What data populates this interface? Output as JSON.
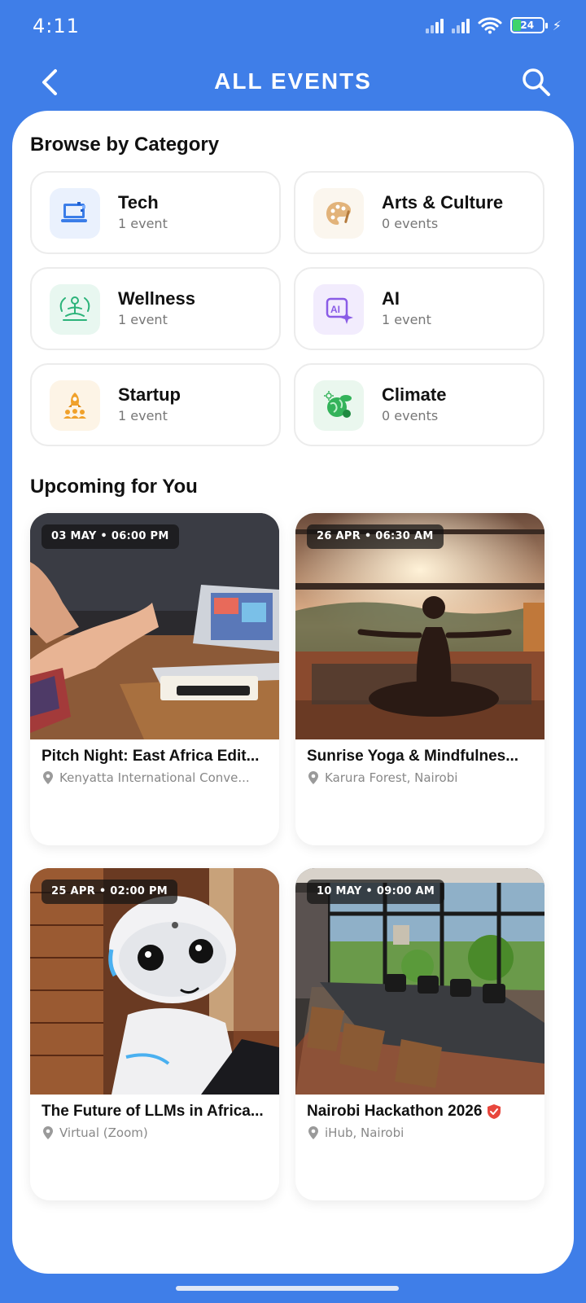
{
  "status_bar": {
    "time": "4:11",
    "battery": "24"
  },
  "header": {
    "title": "ALL EVENTS",
    "back_icon": "chevron-left-icon",
    "search_icon": "search-icon"
  },
  "categories_section": {
    "title": "Browse by Category",
    "items": [
      {
        "name": "Tech",
        "count": "1 event",
        "icon": "laptop-icon",
        "icon_bg": "#eaf1fd",
        "icon_color": "#3b7de8"
      },
      {
        "name": "Arts & Culture",
        "count": "0 events",
        "icon": "palette-icon",
        "icon_bg": "#fbf6ee",
        "icon_color": "#d9a66a"
      },
      {
        "name": "Wellness",
        "count": "1 event",
        "icon": "meditation-icon",
        "icon_bg": "#e8f7f0",
        "icon_color": "#2cb37a"
      },
      {
        "name": "AI",
        "count": "1 event",
        "icon": "ai-sparkle-icon",
        "icon_bg": "#f2ecfd",
        "icon_color": "#8a5ce6"
      },
      {
        "name": "Startup",
        "count": "1 event",
        "icon": "rocket-team-icon",
        "icon_bg": "#fdf4e6",
        "icon_color": "#f0a12b"
      },
      {
        "name": "Climate",
        "count": "0 events",
        "icon": "globe-leaf-icon",
        "icon_bg": "#eaf7ee",
        "icon_color": "#34b35a"
      }
    ]
  },
  "upcoming_section": {
    "title": "Upcoming for You",
    "events": [
      {
        "date": "03 MAY • 06:00 PM",
        "title": "Pitch Night: East Africa Edit...",
        "location": "Kenyatta International Conve...",
        "image": "pitch-meeting-photo",
        "verified": false
      },
      {
        "date": "26 APR • 06:30 AM",
        "title": "Sunrise Yoga & Mindfulnes...",
        "location": "Karura Forest, Nairobi",
        "image": "sunrise-yoga-photo",
        "verified": false
      },
      {
        "date": "25 APR • 02:00 PM",
        "title": "The Future of LLMs in Africa...",
        "location": "Virtual (Zoom)",
        "image": "robot-photo",
        "verified": false
      },
      {
        "date": "10 MAY • 09:00 AM",
        "title": "Nairobi Hackathon 2026",
        "location": "iHub, Nairobi",
        "image": "conference-room-photo",
        "verified": true
      }
    ]
  },
  "colors": {
    "brand": "#3f7ee8",
    "verified_badge": "#e8473d"
  }
}
